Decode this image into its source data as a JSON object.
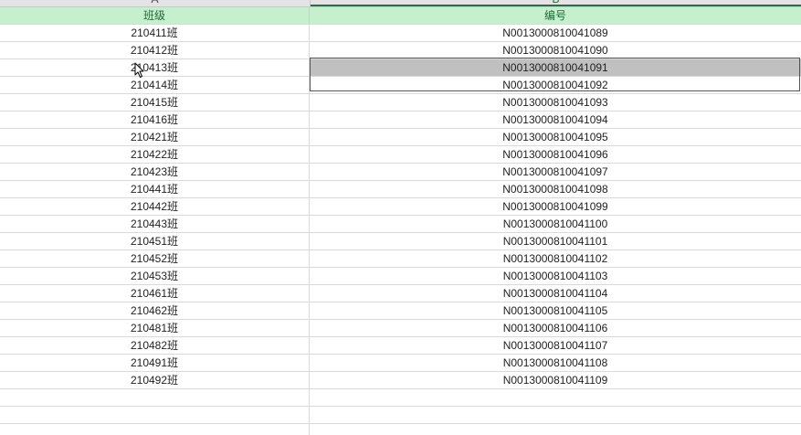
{
  "sheet": {
    "column_letters": [
      "A",
      "B"
    ],
    "header": {
      "col_a": "班级",
      "col_b": "编号"
    },
    "rows": [
      {
        "col_a": "210411班",
        "col_b": "N0013000810041089"
      },
      {
        "col_a": "210412班",
        "col_b": "N0013000810041090"
      },
      {
        "col_a": "210413班",
        "col_b": "N0013000810041091"
      },
      {
        "col_a": "210414班",
        "col_b": "N0013000810041092"
      },
      {
        "col_a": "210415班",
        "col_b": "N0013000810041093"
      },
      {
        "col_a": "210416班",
        "col_b": "N0013000810041094"
      },
      {
        "col_a": "210421班",
        "col_b": "N0013000810041095"
      },
      {
        "col_a": "210422班",
        "col_b": "N0013000810041096"
      },
      {
        "col_a": "210423班",
        "col_b": "N0013000810041097"
      },
      {
        "col_a": "210441班",
        "col_b": "N0013000810041098"
      },
      {
        "col_a": "210442班",
        "col_b": "N0013000810041099"
      },
      {
        "col_a": "210443班",
        "col_b": "N0013000810041100"
      },
      {
        "col_a": "210451班",
        "col_b": "N0013000810041101"
      },
      {
        "col_a": "210452班",
        "col_b": "N0013000810041102"
      },
      {
        "col_a": "210453班",
        "col_b": "N0013000810041103"
      },
      {
        "col_a": "210461班",
        "col_b": "N0013000810041104"
      },
      {
        "col_a": "210462班",
        "col_b": "N0013000810041105"
      },
      {
        "col_a": "210481班",
        "col_b": "N0013000810041106"
      },
      {
        "col_a": "210482班",
        "col_b": "N0013000810041107"
      },
      {
        "col_a": "210491班",
        "col_b": "N0013000810041108"
      },
      {
        "col_a": "210492班",
        "col_b": "N0013000810041109"
      },
      {
        "col_a": "",
        "col_b": ""
      },
      {
        "col_a": "",
        "col_b": ""
      },
      {
        "col_a": "",
        "col_b": ""
      }
    ],
    "selected_rows": [
      2,
      3
    ],
    "colors": {
      "header_fill": "#c6efce",
      "header_text": "#1e6b35",
      "selection_border": "#217346",
      "selection_fill": "#c0c0c0"
    },
    "cursor_icon": "mouse-pointer-icon"
  }
}
